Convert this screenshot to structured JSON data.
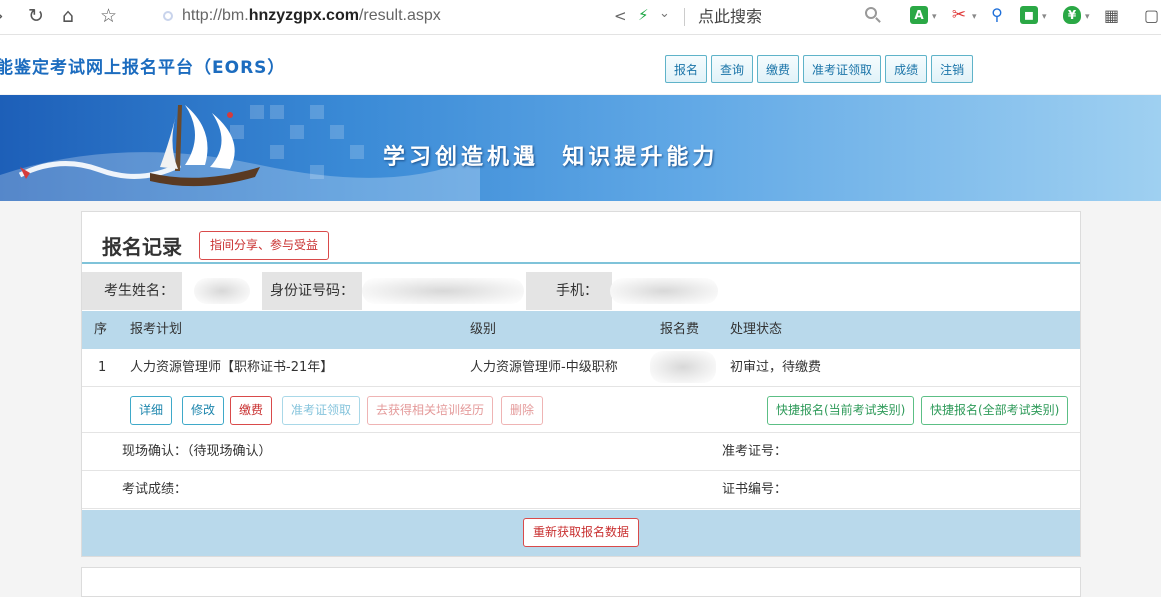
{
  "browser": {
    "url_prefix": "http://bm.",
    "url_domain": "hnzyzgpx.com",
    "url_path": "/result.aspx",
    "search_placeholder": "点此搜索",
    "ext_a_label": "A",
    "ext_a_color": "#2aa845",
    "ext_scissors_color": "#e03a3a",
    "ext_search_color": "#1e6fd9",
    "ext_game_color": "#2aa845",
    "ext_shield_color": "#2aa845"
  },
  "site": {
    "title": "能鉴定考试网上报名平台（EORS）",
    "nav": [
      "报名",
      "查询",
      "缴费",
      "准考证领取",
      "成绩",
      "注销"
    ],
    "slogan": "学习创造机遇  知识提升能力"
  },
  "record": {
    "title": "报名记录",
    "share_button": "指间分享、参与受益",
    "info": {
      "name_label": "考生姓名：",
      "id_label": "身份证号码：",
      "phone_label": "手机："
    },
    "columns": [
      "序",
      "报考计划",
      "级别",
      "报名费",
      "处理状态"
    ],
    "row": {
      "index": "1",
      "plan": "人力资源管理师【职称证书-21年】",
      "level": "人力资源管理师-中级职称",
      "status": "初审过，待缴费"
    },
    "actions": [
      "详细",
      "修改",
      "缴费",
      "准考证领取",
      "去获得相关培训经历",
      "删除"
    ],
    "quick_actions": [
      "快捷报名(当前考试类别)",
      "快捷报名(全部考试类别)"
    ],
    "onsite_label": "现场确认：（待现场确认）",
    "ticket_label": "准考证号：",
    "score_label": "考试成绩：",
    "cert_label": "证书编号：",
    "refresh_button": "重新获取报名数据"
  }
}
